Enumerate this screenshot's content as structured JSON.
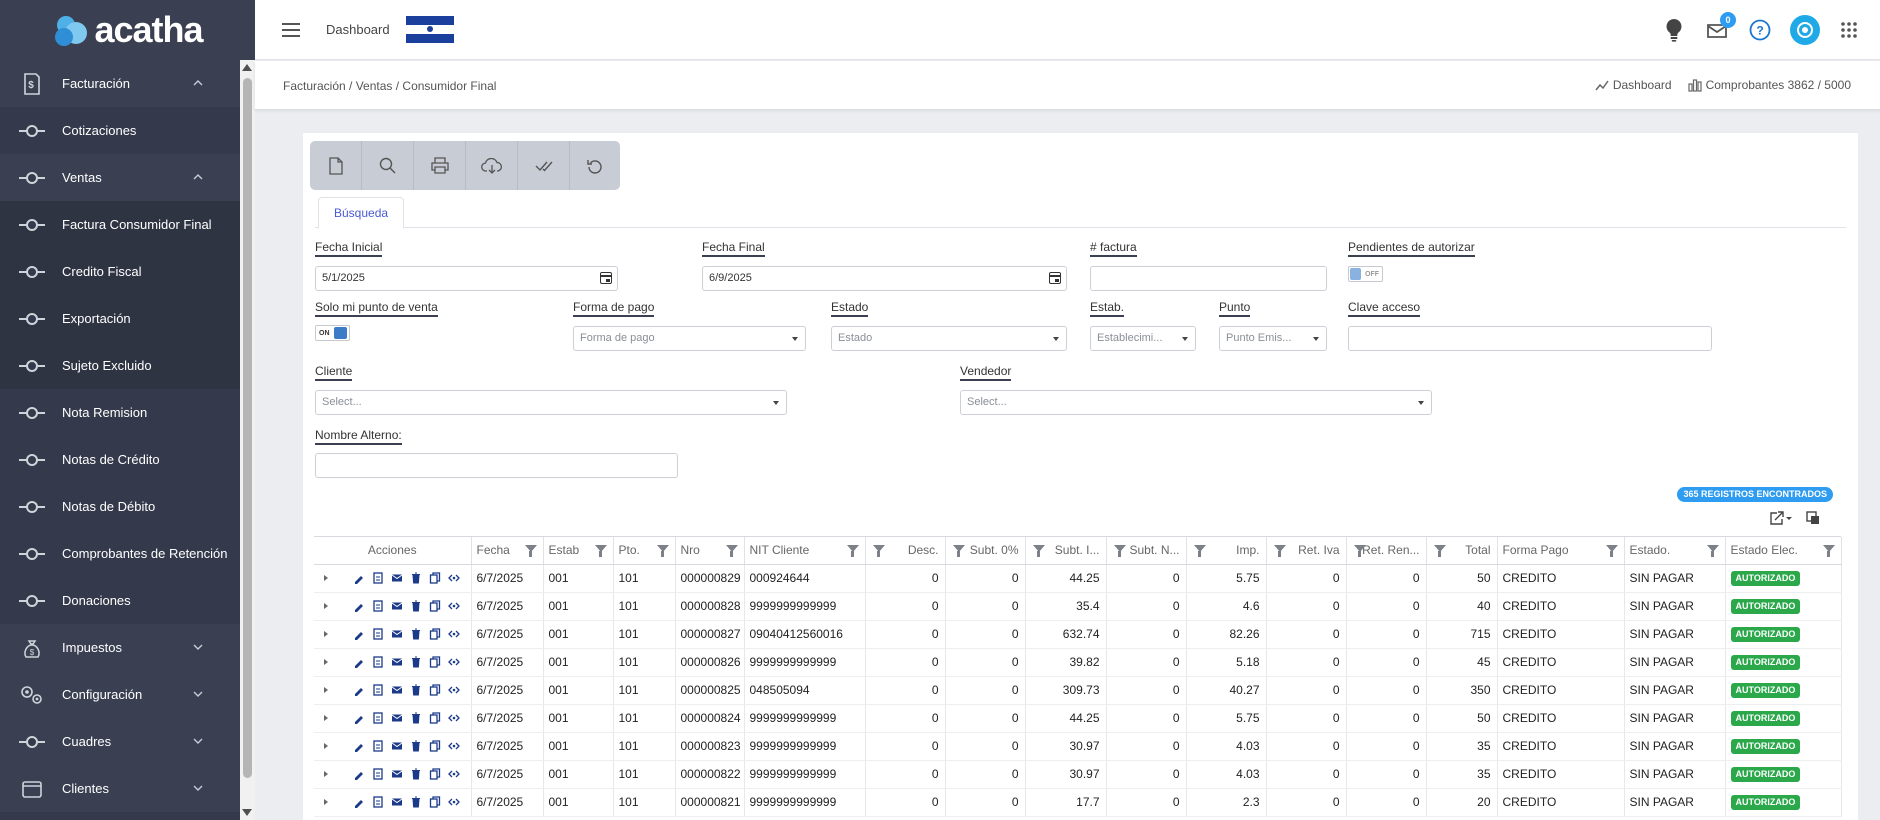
{
  "brand": {
    "name": "acatha"
  },
  "topbar": {
    "dashboard_label": "Dashboard",
    "mail_count": "0"
  },
  "sidebar": {
    "items": [
      {
        "label": "Facturación",
        "kind": "top",
        "icon": "invoice-icon",
        "expanded": true
      },
      {
        "label": "Cotizaciones",
        "kind": "sub"
      },
      {
        "label": "Ventas",
        "kind": "top-sub",
        "expanded": true
      },
      {
        "label": "Factura Consumidor Final",
        "kind": "active"
      },
      {
        "label": "Credito Fiscal",
        "kind": "dark"
      },
      {
        "label": "Exportación",
        "kind": "dark"
      },
      {
        "label": "Sujeto Excluido",
        "kind": "dark"
      },
      {
        "label": "Nota Remision",
        "kind": "sub"
      },
      {
        "label": "Notas de Crédito",
        "kind": "sub"
      },
      {
        "label": "Notas de Débito",
        "kind": "sub"
      },
      {
        "label": "Comprobantes de Retención",
        "kind": "sub"
      },
      {
        "label": "Donaciones",
        "kind": "sub"
      },
      {
        "label": "Impuestos",
        "kind": "top",
        "icon": "money-bag-icon",
        "expanded": false
      },
      {
        "label": "Configuración",
        "kind": "top",
        "icon": "settings-icon",
        "expanded": false
      },
      {
        "label": "Cuadres",
        "kind": "top-bullet",
        "expanded": false
      },
      {
        "label": "Clientes",
        "kind": "top",
        "icon": "wallet-icon",
        "expanded": false
      }
    ]
  },
  "breadcrumb": {
    "path": "Facturación / Ventas / Consumidor Final",
    "dashboard_link": "Dashboard",
    "comprobantes": "Comprobantes 3862 / 5000"
  },
  "tabs": {
    "search": "Búsqueda"
  },
  "filters": {
    "fecha_inicial": {
      "label": "Fecha Inicial",
      "value": "5/1/2025"
    },
    "fecha_final": {
      "label": "Fecha Final",
      "value": "6/9/2025"
    },
    "factura": {
      "label": "# factura",
      "value": ""
    },
    "pendientes": {
      "label": "Pendientes de autorizar",
      "state": "OFF"
    },
    "solo_punto": {
      "label": "Solo mi punto de venta",
      "state": "ON"
    },
    "forma_pago": {
      "label": "Forma de pago",
      "placeholder": "Forma de pago"
    },
    "estado": {
      "label": "Estado",
      "placeholder": "Estado"
    },
    "estab": {
      "label": "Estab.",
      "placeholder": "Establecimi..."
    },
    "punto": {
      "label": "Punto",
      "placeholder": "Punto Emis..."
    },
    "clave": {
      "label": "Clave acceso",
      "value": ""
    },
    "cliente": {
      "label": "Cliente",
      "placeholder": "Select..."
    },
    "vendedor": {
      "label": "Vendedor",
      "placeholder": "Select..."
    },
    "nombre_alterno": {
      "label": "Nombre Alterno:",
      "value": ""
    }
  },
  "records_badge": "365 REGISTROS ENCONTRADOS",
  "table": {
    "columns": [
      "Acciones",
      "Fecha",
      "Estab",
      "Pto.",
      "Nro",
      "NIT Cliente",
      "Desc.",
      "Subt. 0%",
      "Subt. I...",
      "Subt. N...",
      "Imp.",
      "Ret. Iva",
      "Ret. Ren...",
      "Total",
      "Forma Pago",
      "Estado.",
      "Estado Elec."
    ],
    "rows": [
      [
        "6/7/2025",
        "001",
        "101",
        "000000829",
        "000924644",
        "0",
        "0",
        "44.25",
        "0",
        "5.75",
        "0",
        "0",
        "50",
        "CREDITO",
        "SIN PAGAR",
        "AUTORIZADO"
      ],
      [
        "6/7/2025",
        "001",
        "101",
        "000000828",
        "9999999999999",
        "0",
        "0",
        "35.4",
        "0",
        "4.6",
        "0",
        "0",
        "40",
        "CREDITO",
        "SIN PAGAR",
        "AUTORIZADO"
      ],
      [
        "6/7/2025",
        "001",
        "101",
        "000000827",
        "09040412560016",
        "0",
        "0",
        "632.74",
        "0",
        "82.26",
        "0",
        "0",
        "715",
        "CREDITO",
        "SIN PAGAR",
        "AUTORIZADO"
      ],
      [
        "6/7/2025",
        "001",
        "101",
        "000000826",
        "9999999999999",
        "0",
        "0",
        "39.82",
        "0",
        "5.18",
        "0",
        "0",
        "45",
        "CREDITO",
        "SIN PAGAR",
        "AUTORIZADO"
      ],
      [
        "6/7/2025",
        "001",
        "101",
        "000000825",
        "048505094",
        "0",
        "0",
        "309.73",
        "0",
        "40.27",
        "0",
        "0",
        "350",
        "CREDITO",
        "SIN PAGAR",
        "AUTORIZADO"
      ],
      [
        "6/7/2025",
        "001",
        "101",
        "000000824",
        "9999999999999",
        "0",
        "0",
        "44.25",
        "0",
        "5.75",
        "0",
        "0",
        "50",
        "CREDITO",
        "SIN PAGAR",
        "AUTORIZADO"
      ],
      [
        "6/7/2025",
        "001",
        "101",
        "000000823",
        "9999999999999",
        "0",
        "0",
        "30.97",
        "0",
        "4.03",
        "0",
        "0",
        "35",
        "CREDITO",
        "SIN PAGAR",
        "AUTORIZADO"
      ],
      [
        "6/7/2025",
        "001",
        "101",
        "000000822",
        "9999999999999",
        "0",
        "0",
        "30.97",
        "0",
        "4.03",
        "0",
        "0",
        "35",
        "CREDITO",
        "SIN PAGAR",
        "AUTORIZADO"
      ],
      [
        "6/7/2025",
        "001",
        "101",
        "000000821",
        "9999999999999",
        "0",
        "0",
        "17.7",
        "0",
        "2.3",
        "0",
        "0",
        "20",
        "CREDITO",
        "SIN PAGAR",
        "AUTORIZADO"
      ]
    ]
  },
  "colors": {
    "sidebar": "#343a4b",
    "accent": "#2e9cf0",
    "status_ok": "#2aa84a",
    "tab_text": "#4a5ad6"
  }
}
